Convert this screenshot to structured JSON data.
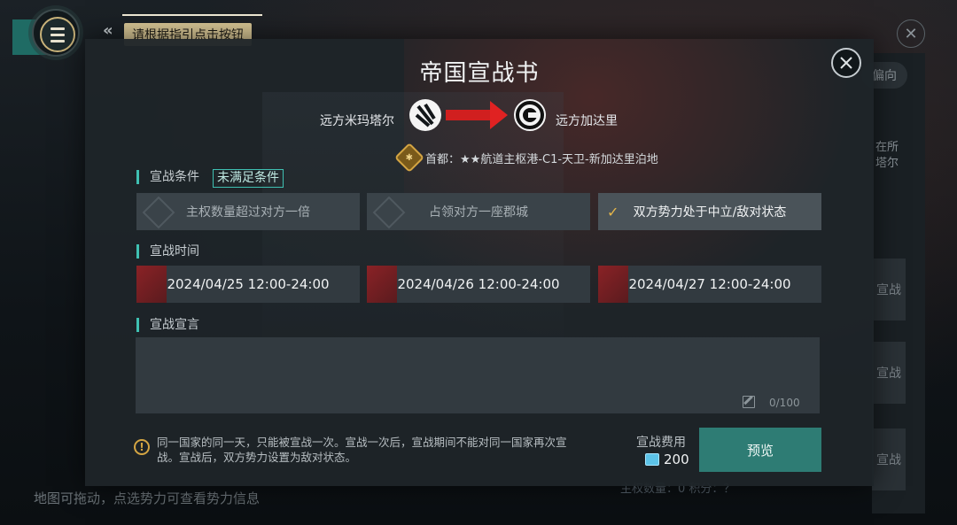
{
  "background": {
    "map_hint": "地图可拖动，点选势力可查看势力信息",
    "bottom_ghost": "主权数量：0   积分：？",
    "side_tab": "偏向",
    "side_text": [
      "在所",
      "塔尔"
    ],
    "side_tiles": [
      "宣战",
      "宣战",
      "宣战"
    ]
  },
  "top": {
    "back_glyph": "«",
    "tooltip": "请根据指引点击按钮"
  },
  "dialog": {
    "title": "帝国宣战书",
    "attacker": "远方米玛塔尔",
    "defender": "远方加达里",
    "capital_label": "首都：",
    "capital_value": "★★航道主枢港-C1-天卫-新加达里泊地",
    "conditions_label": "宣战条件",
    "conditions_status": "未满足条件",
    "conditions": [
      {
        "label": "主权数量超过对方一倍",
        "met": false
      },
      {
        "label": "占领对方一座郡城",
        "met": false
      },
      {
        "label": "双方势力处于中立/敌对状态",
        "met": true
      }
    ],
    "time_label": "宣战时间",
    "times": [
      "2024/04/25 12:00-24:00",
      "2024/04/26 12:00-24:00",
      "2024/04/27 12:00-24:00"
    ],
    "declaration_label": "宣战宣言",
    "declaration_value": "",
    "char_count": "0/100",
    "notice": "同一国家的同一天，只能被宣战一次。宣战一次后，宣战期间不能对同一国家再次宣战。宣战后，双方势力设置为敌对状态。",
    "cost_label": "宣战费用",
    "cost_value": "200",
    "preview_button": "预览"
  },
  "colors": {
    "accent_teal": "#3fc0b2",
    "button_teal": "#2e7c74",
    "gold": "#d4a543",
    "arrow_red": "#d11f1f"
  },
  "icons": [
    "menu-icon",
    "back-chevron-icon",
    "close-icon",
    "attacker-emblem-icon",
    "defender-emblem-icon",
    "capital-badge-icon",
    "check-icon",
    "edit-icon",
    "warning-icon",
    "currency-gem-icon"
  ]
}
